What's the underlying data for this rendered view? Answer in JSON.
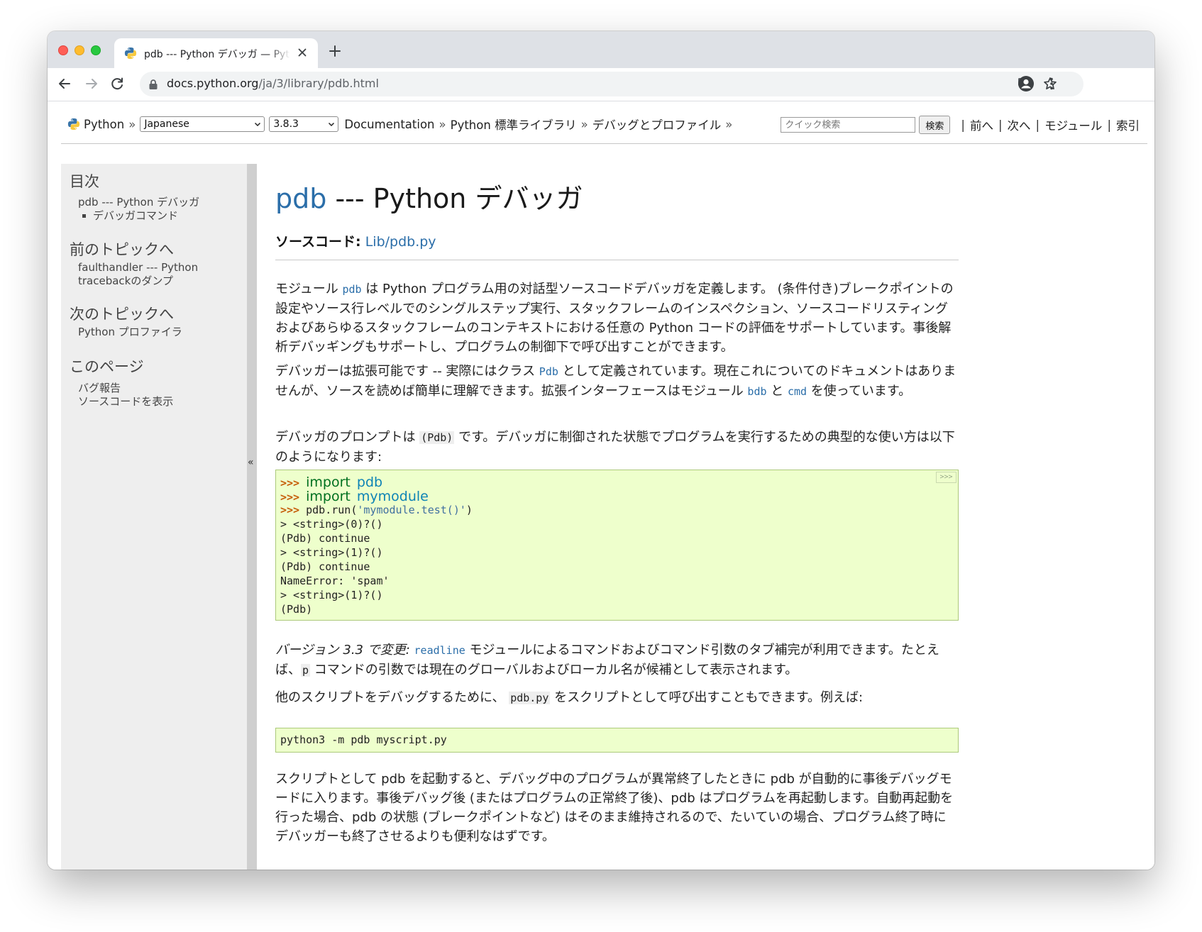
{
  "browser": {
    "tab_title": "pdb --- Python デバッガ — Python",
    "url_host": "docs.python.org",
    "url_path": "/ja/3/library/pdb.html"
  },
  "related_nav": {
    "python_label": "Python",
    "sep": "»",
    "language_select": "Japanese",
    "version_select": "3.8.3",
    "crumbs": [
      "Documentation",
      "Python 標準ライブラリ",
      "デバッグとプロファイル"
    ],
    "search_placeholder": "クイック検索",
    "search_button": "検索",
    "links": [
      "前へ",
      "次へ",
      "モジュール",
      "索引"
    ]
  },
  "sidebar": {
    "toc_heading": "目次",
    "toc_item": "pdb --- Python デバッガ",
    "toc_subitem": "デバッガコマンド",
    "prev_heading": "前のトピックへ",
    "prev_line1": "faulthandler --- Python",
    "prev_line2": "tracebackのダンプ",
    "next_heading": "次のトピックへ",
    "next_link": "Python プロファイラ",
    "this_page_heading": "このページ",
    "bug_report": "バグ報告",
    "show_source": "ソースコードを表示",
    "collapse": "«"
  },
  "content": {
    "title_module": "pdb",
    "title_rest": " --- Python デバッガ",
    "source_label": "ソースコード:",
    "source_link": "Lib/pdb.py",
    "p1": {
      "a": "モジュール ",
      "code": "pdb",
      "b": " は Python プログラム用の対話型ソースコードデバッガを定義します。 (条件付き)ブレークポイントの設定やソース行レベルでのシングルステップ実行、スタックフレームのインスペクション、ソースコードリスティングおよびあらゆるスタックフレームのコンテキストにおける任意の Python コードの評価をサポートしています。事後解析デバッギングもサポートし、プログラムの制御下で呼び出すことができます。"
    },
    "p2": {
      "a": "デバッガーは拡張可能です -- 実際にはクラス ",
      "code1": "Pdb",
      "b": " として定義されています。現在これについてのドキュメントはありませんが、ソースを読めば簡単に理解できます。拡張インターフェースはモジュール ",
      "code2": "bdb",
      "c": " と ",
      "code3": "cmd",
      "d": " を使っています。"
    },
    "p3": {
      "a": "デバッガのプロンプトは ",
      "code": "(Pdb)",
      "b": " です。デバッガに制御された状態でプログラムを実行するための典型的な使い方は以下のようになります:"
    },
    "code1": {
      "copy_label": ">>>",
      "prompt": ">>> ",
      "kw_import": "import",
      "mod_pdb": "pdb",
      "mod_mymodule": "mymodule",
      "run_a": "pdb.run(",
      "run_str": "'mymodule.test()'",
      "run_b": ")",
      "out": [
        "> <string>(0)?()",
        "(Pdb) continue",
        "> <string>(1)?()",
        "(Pdb) continue",
        "NameError: 'spam'",
        "> <string>(1)?()",
        "(Pdb)"
      ]
    },
    "p4": {
      "version": "バージョン 3.3 で変更:",
      "code1": "readline",
      "a": " モジュールによるコマンドおよびコマンド引数のタブ補完が利用できます。たとえば、",
      "code2": "p",
      "b": " コマンドの引数では現在のグローバルおよびローカル名が候補として表示されます。"
    },
    "p5": {
      "a": "他のスクリプトをデバッグするために、 ",
      "code": "pdb.py",
      "b": " をスクリプトとして呼び出すこともできます。例えば:"
    },
    "code2": "python3 -m pdb myscript.py",
    "p6": "スクリプトとして pdb を起動すると、デバッグ中のプログラムが異常終了したときに pdb が自動的に事後デバッグモードに入ります。事後デバッグ後 (またはプログラムの正常終了後)、pdb はプログラムを再起動します。自動再起動を行った場合、pdb の状態 (ブレークポイントなど) はそのまま維持されるので、たいていの場合、プログラム終了時にデバッガーも終了させるよりも便利なはずです。"
  }
}
